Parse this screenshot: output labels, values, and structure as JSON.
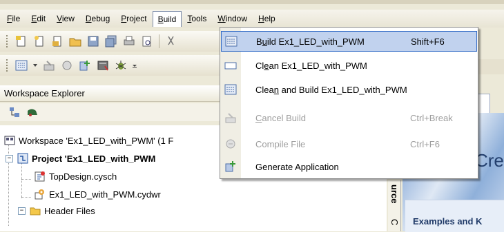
{
  "menubar": {
    "items": [
      {
        "label": "File",
        "u": "F",
        "rest": "ile"
      },
      {
        "label": "Edit",
        "u": "E",
        "rest": "dit"
      },
      {
        "label": "View",
        "u": "V",
        "rest": "iew"
      },
      {
        "label": "Debug",
        "u": "D",
        "rest": "ebug"
      },
      {
        "label": "Project",
        "u": "P",
        "rest": "roject"
      },
      {
        "label": "Build",
        "u": "B",
        "rest": "uild"
      },
      {
        "label": "Tools",
        "u": "T",
        "rest": "ools"
      },
      {
        "label": "Window",
        "u": "W",
        "rest": "indow"
      },
      {
        "label": "Help",
        "u": "H",
        "rest": "elp"
      }
    ],
    "active": "Build"
  },
  "workspace_explorer": {
    "title": "Workspace Explorer",
    "tree": {
      "workspace": "Workspace 'Ex1_LED_with_PWM' (1 F",
      "project": "Project 'Ex1_LED_with_PWM",
      "topdesign": "TopDesign.cysch",
      "cydwr": "Ex1_LED_with_PWM.cydwr",
      "header_files": "Header Files"
    }
  },
  "build_menu": {
    "items": [
      {
        "pre": "B",
        "u": "u",
        "post": "ild Ex1_LED_with_PWM",
        "shortcut": "Shift+F6",
        "enabled": true,
        "highlighted": true,
        "icon": "build-icon"
      },
      {
        "pre": "Cl",
        "u": "e",
        "post": "an Ex1_LED_with_PWM",
        "shortcut": "",
        "enabled": true,
        "highlighted": false,
        "icon": "clean-icon"
      },
      {
        "pre": "Clea",
        "u": "n",
        "post": " and Build Ex1_LED_with_PWM",
        "shortcut": "",
        "enabled": true,
        "highlighted": false,
        "icon": "clean-build-icon"
      },
      {
        "pre": "",
        "u": "C",
        "post": "ancel Build",
        "shortcut": "Ctrl+Break",
        "enabled": false,
        "highlighted": false,
        "icon": "cancel-build-icon"
      },
      {
        "pre": "Compile File",
        "u": "",
        "post": "",
        "shortcut": "Ctrl+F6",
        "enabled": false,
        "highlighted": false,
        "icon": "compile-icon"
      },
      {
        "pre": "Generate Application",
        "u": "",
        "post": "",
        "shortcut": "",
        "enabled": true,
        "highlighted": false,
        "icon": "generate-app-icon"
      }
    ]
  },
  "start_page": {
    "title_fragment": "Cre",
    "examples_fragment": "Examples and K",
    "vertical_tab_1": "urce",
    "vertical_tab_2": "C"
  }
}
